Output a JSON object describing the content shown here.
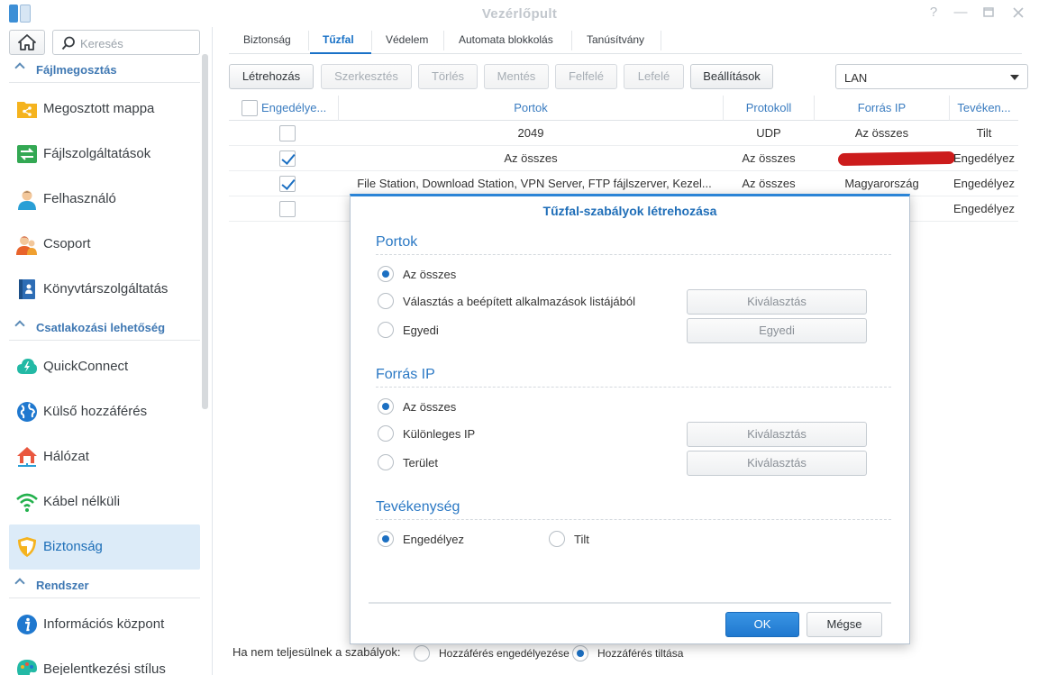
{
  "window": {
    "title": "Vezérlőpult",
    "controls": [
      "help-icon",
      "minimize-icon",
      "maximize-icon",
      "close-icon"
    ]
  },
  "sidebar": {
    "search_placeholder": "Keresés",
    "sections": [
      {
        "label": "Fájlmegosztás",
        "items": [
          {
            "label": "Megosztott mappa",
            "icon": "shared-folder-icon"
          },
          {
            "label": "Fájlszolgáltatások",
            "icon": "file-services-icon"
          },
          {
            "label": "Felhasználó",
            "icon": "user-icon"
          },
          {
            "label": "Csoport",
            "icon": "group-icon"
          },
          {
            "label": "Könyvtárszolgáltatás",
            "icon": "directory-icon"
          }
        ]
      },
      {
        "label": "Csatlakozási lehetőség",
        "items": [
          {
            "label": "QuickConnect",
            "icon": "quickconnect-icon"
          },
          {
            "label": "Külső hozzáférés",
            "icon": "globe-icon"
          },
          {
            "label": "Hálózat",
            "icon": "network-house-icon"
          },
          {
            "label": "Kábel nélküli",
            "icon": "wifi-icon"
          },
          {
            "label": "Biztonság",
            "icon": "shield-icon",
            "active": true
          }
        ]
      },
      {
        "label": "Rendszer",
        "items": [
          {
            "label": "Információs központ",
            "icon": "info-icon"
          },
          {
            "label": "Bejelentkezési stílus",
            "icon": "palette-icon"
          }
        ]
      }
    ]
  },
  "tabs": [
    "Biztonság",
    "Tűzfal",
    "Védelem",
    "Automata blokkolás",
    "Tanúsítvány"
  ],
  "active_tab": "Tűzfal",
  "toolbar": {
    "create": "Létrehozás",
    "edit": "Szerkesztés",
    "delete": "Törlés",
    "save": "Mentés",
    "up": "Felfelé",
    "down": "Lefelé",
    "settings": "Beállítások",
    "profile_select": "LAN"
  },
  "table": {
    "headers": [
      "Engedélye...",
      "Portok",
      "Protokoll",
      "Forrás IP",
      "Tevéken..."
    ],
    "rows": [
      {
        "enabled": false,
        "ports": "2049",
        "protocol": "UDP",
        "source_ip": "Az összes",
        "action": "Tilt"
      },
      {
        "enabled": true,
        "ports": "Az összes",
        "protocol": "Az összes",
        "source_ip": "",
        "action": "Engedélyez"
      },
      {
        "enabled": true,
        "ports": "File Station, Download Station, VPN Server, FTP fájlszerver, Kezel...",
        "protocol": "Az összes",
        "source_ip": "Magyarország",
        "action": "Engedélyez"
      },
      {
        "enabled": false,
        "ports": "",
        "protocol": "",
        "source_ip": "",
        "action": "Engedélyez"
      }
    ]
  },
  "footer": {
    "label": "Ha nem teljesülnek a szabályok:",
    "allow": "Hozzáférés engedélyezése",
    "deny": "Hozzáférés tiltása",
    "selected": "deny"
  },
  "dialog": {
    "title": "Tűzfal-szabályok létrehozása",
    "ports": {
      "title": "Portok",
      "all": "Az összes",
      "builtin": "Választás a beépített alkalmazások listájából",
      "custom": "Egyedi",
      "select_btn": "Kiválasztás",
      "custom_btn": "Egyedi",
      "selected": "all"
    },
    "source_ip": {
      "title": "Forrás IP",
      "all": "Az összes",
      "specific": "Különleges IP",
      "region": "Terület",
      "select_btn_1": "Kiválasztás",
      "select_btn_2": "Kiválasztás",
      "selected": "all"
    },
    "action": {
      "title": "Tevékenység",
      "allow": "Engedélyez",
      "deny": "Tilt",
      "selected": "allow"
    },
    "ok": "OK",
    "cancel": "Mégse"
  },
  "colors": {
    "accent": "#1a72c7",
    "active_bg": "#dcebf8",
    "redaction": "#cc1c1c"
  }
}
